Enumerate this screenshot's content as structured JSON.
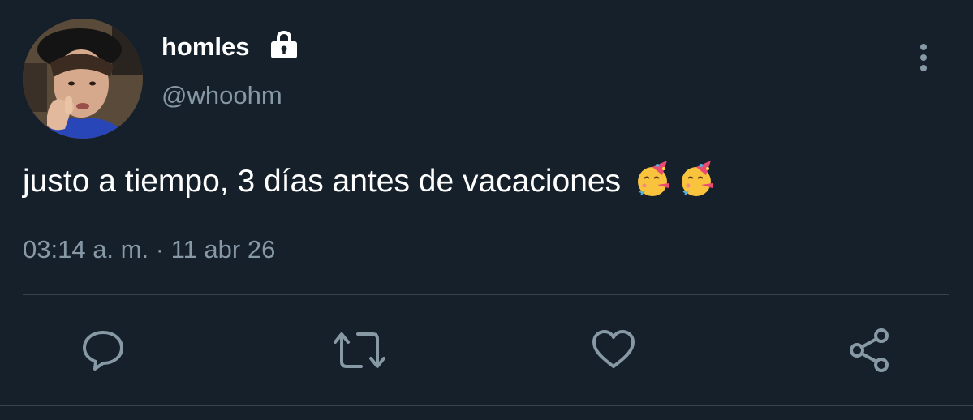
{
  "author": {
    "display_name": "homles",
    "handle": "@whoohm",
    "protected_icon": "lock-icon",
    "avatar": "profile-photo"
  },
  "tweet": {
    "text": "justo a tiempo, 3 días antes de vacaciones",
    "emojis": [
      "partying-face",
      "partying-face"
    ],
    "timestamp": "03:14 a. m. · 11 abr 26"
  },
  "menu_icon": "more-vertical-icon",
  "actions": [
    {
      "name": "reply",
      "icon": "comment-icon"
    },
    {
      "name": "retweet",
      "icon": "retweet-icon"
    },
    {
      "name": "like",
      "icon": "heart-icon"
    },
    {
      "name": "share",
      "icon": "share-icon"
    }
  ],
  "colors": {
    "background": "#15202b",
    "primary_text": "#ffffff",
    "secondary_text": "#8899a6",
    "divider": "#38444d"
  }
}
